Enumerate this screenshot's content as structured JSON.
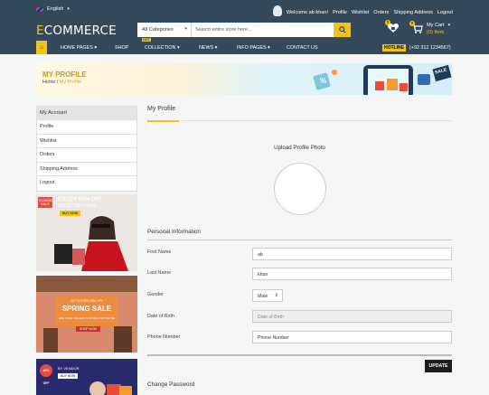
{
  "topbar": {
    "language": "English",
    "links": [
      "Welcome ab khan!",
      "Profile",
      "Wishlist",
      "Orders",
      "Shipping Address",
      "Logout"
    ]
  },
  "header": {
    "logo_e": "E",
    "logo_rest": "COMMERCE",
    "category": "All Categories",
    "search_placeholder": "Search entire store here...",
    "wishlist_count": "0",
    "cart_count": "0",
    "cart_title": "My Cart",
    "cart_sub": "(0) Item"
  },
  "nav": {
    "items": [
      "HOME PAGES",
      "SHOP",
      "COLLECTION",
      "NEWS",
      "INFO PAGES",
      "CONTACT US"
    ],
    "hot_badge": "HOT",
    "hotline": "HOTLINE",
    "phone": "(+92 312 1234567)"
  },
  "banner": {
    "title": "MY PROFILE",
    "crumb_home": "Home",
    "crumb_sep": "/",
    "crumb_current": "My Profile",
    "sale": "SALE",
    "percent": "%"
  },
  "sidebar": {
    "heading": "My Account",
    "items": [
      "Profile",
      "Wishlist",
      "Orders",
      "Shipping Address",
      "Logout"
    ]
  },
  "promos": {
    "p1_tag": "SUMMER SALE",
    "p1_line1": "ENJOY 50% OFF",
    "p1_line2": "SELECTED ITEMS",
    "p1_btn": "BUY NOW",
    "p2_line1": "GET EXTRA 30% OFF",
    "p2_line2": "SPRING SALE",
    "p2_line3": "USE CODE: SALE30 IN STORE AND ONLINE",
    "p2_btn": "SHOP NOW",
    "p3_tag": "40% OFF",
    "p3_line1": "BY VENDOR",
    "p3_btn": "BUY NOW"
  },
  "main": {
    "title": "My Profile",
    "upload_label": "Upload Profile Photo",
    "personal_heading": "Personal Information",
    "fields": {
      "first_name_label": "First Name",
      "first_name_value": "ab",
      "last_name_label": "Last Name",
      "last_name_value": "khan",
      "gender_label": "Gender",
      "gender_value": "Male",
      "dob_label": "Date of Birth",
      "dob_placeholder": "Date of Birth",
      "phone_label": "Phone Number",
      "phone_placeholder": "Phone Number"
    },
    "update_btn": "UPDATE",
    "password_heading": "Change Password"
  },
  "colors": {
    "accent": "#f2c318",
    "header": "#34495a",
    "dark_button": "#1c1c1c"
  }
}
